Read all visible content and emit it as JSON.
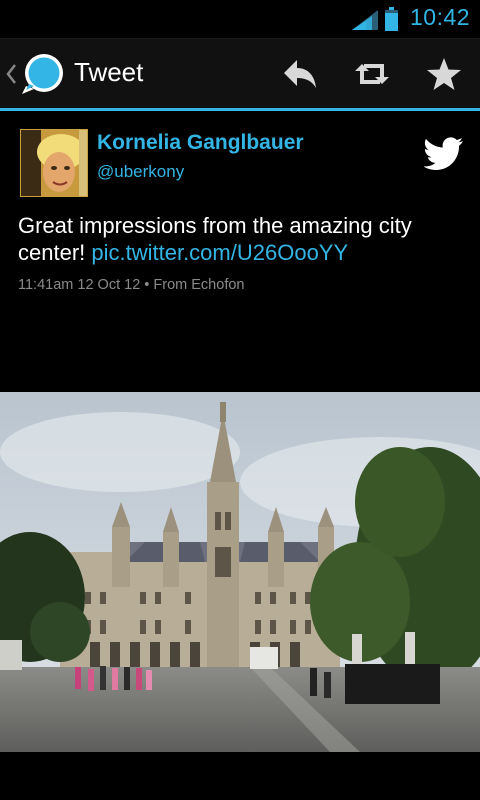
{
  "status_bar": {
    "time": "10:42",
    "signal_icon": "signal-icon",
    "battery_icon": "battery-icon"
  },
  "action_bar": {
    "title": "Tweet",
    "logo_icon": "speech-bubble-logo-icon",
    "actions": [
      {
        "name": "reply",
        "icon": "reply-icon"
      },
      {
        "name": "retweet",
        "icon": "retweet-icon"
      },
      {
        "name": "favorite",
        "icon": "star-icon"
      }
    ],
    "accent_color": "#33b5e5"
  },
  "tweet": {
    "author_name": "Kornelia Ganglbauer",
    "author_handle": "@uberkony",
    "text": "Great impressions from the amazing city center! ",
    "link": "pic.twitter.com/U26OooYY",
    "time": "11:41am 12 Oct 12",
    "separator": "•",
    "source": "From Echofon",
    "service_icon": "twitter-bird-icon"
  },
  "photo": {
    "description_icon": "photo-town-hall"
  }
}
